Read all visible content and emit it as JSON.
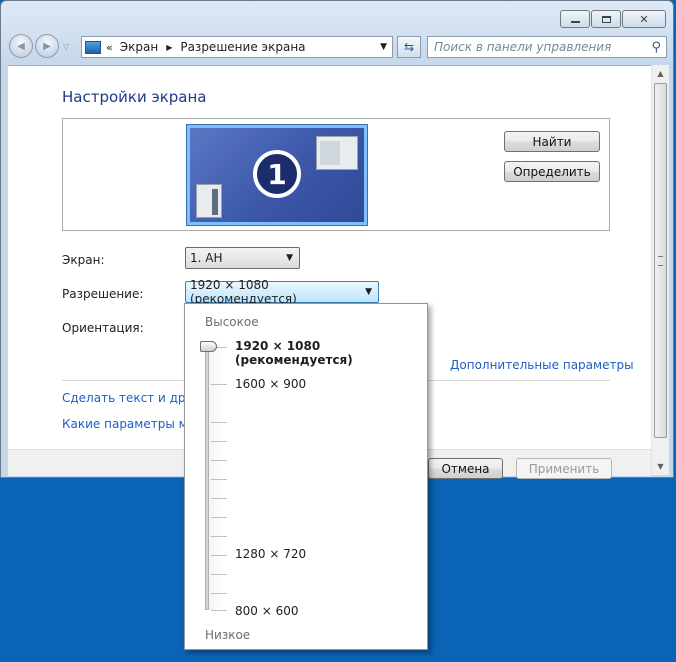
{
  "window": {
    "caption_buttons": [
      "minimize-icon",
      "maximize-icon",
      "close-icon"
    ]
  },
  "navigation": {
    "back_icon": "back-arrow-icon",
    "forward_icon": "forward-arrow-icon"
  },
  "address_bar": {
    "chevron": "«",
    "crumbs": [
      "Экран",
      "Разрешение экрана"
    ]
  },
  "search": {
    "placeholder": "Поиск в панели управления",
    "icon": "search-icon"
  },
  "main": {
    "title": "Настройки экрана",
    "monitor_number": "1",
    "find_button": "Найти",
    "identify_button": "Определить",
    "screen_label": "Экран:",
    "screen_value": "1. AH",
    "resolution_label": "Разрешение:",
    "resolution_value": "1920 × 1080 (рекомендуется)",
    "orientation_label": "Ориентация:",
    "advanced_link": "Дополнительные параметры",
    "text_link": "Сделать текст и другие",
    "monitor_link": "Какие параметры мон",
    "cancel_button": "Отмена",
    "apply_button": "Применить"
  },
  "resolution_popup": {
    "high_label": "Высокое",
    "low_label": "Низкое",
    "options": [
      {
        "label": "1920 × 1080 (рекомендуется)",
        "selected": true
      },
      {
        "label": "1600 × 900",
        "selected": false
      },
      {
        "label": "1280 × 720",
        "selected": false
      },
      {
        "label": "800 × 600",
        "selected": false
      }
    ]
  },
  "colors": {
    "desktop": "#0a63b4",
    "title_text": "#1e3a8a",
    "link": "#1f5fbf"
  }
}
